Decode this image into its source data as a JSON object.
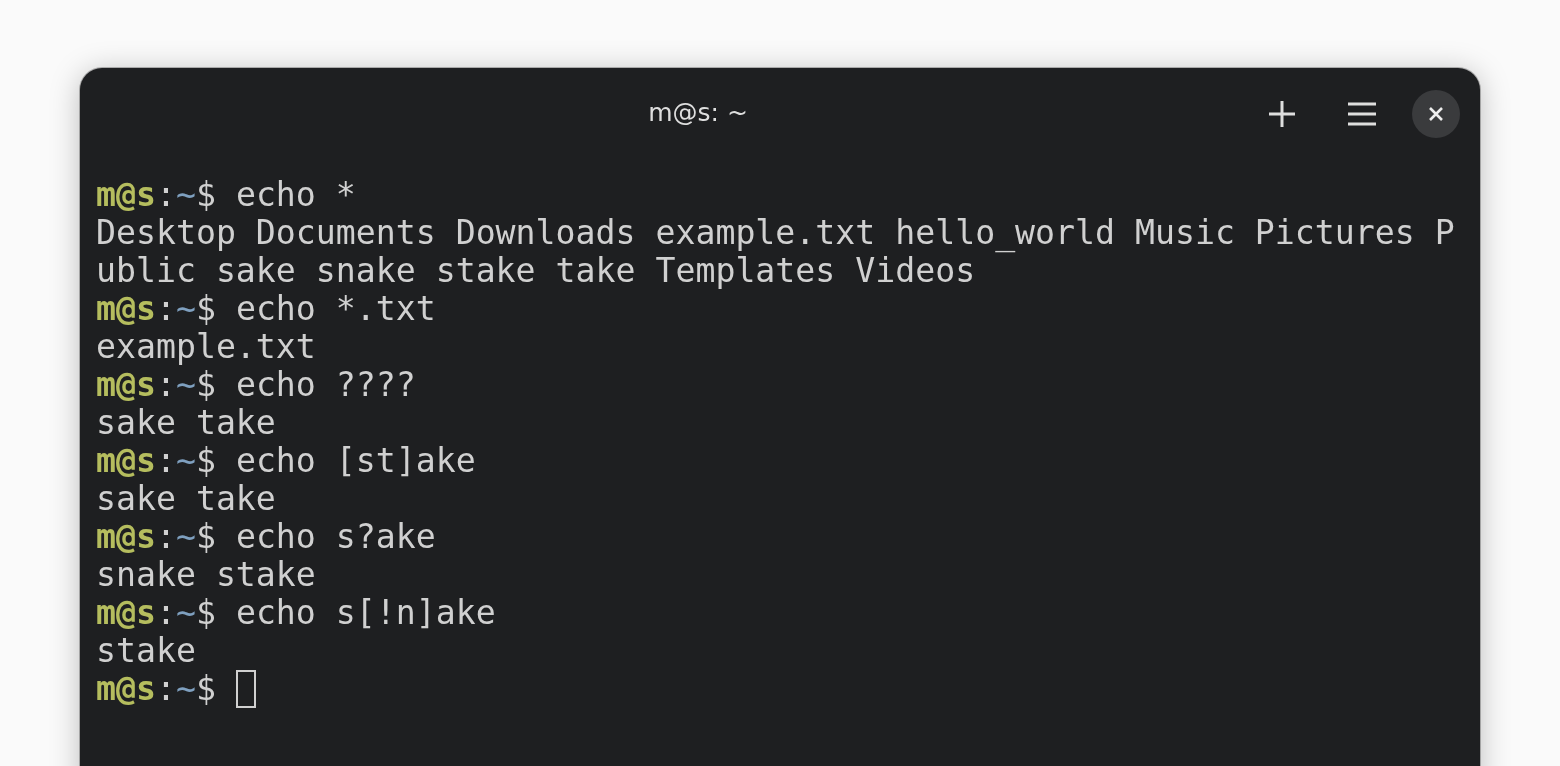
{
  "window": {
    "title": "m@s: ~"
  },
  "lines": [
    {
      "kind": "prompt",
      "user": "m@s",
      "sep": ":",
      "path": "~",
      "symbol": "$",
      "command": "echo *"
    },
    {
      "kind": "output",
      "text": "Desktop Documents Downloads example.txt hello_world Music Pictures P"
    },
    {
      "kind": "output",
      "text": "ublic sake snake stake take Templates Videos"
    },
    {
      "kind": "prompt",
      "user": "m@s",
      "sep": ":",
      "path": "~",
      "symbol": "$",
      "command": "echo *.txt"
    },
    {
      "kind": "output",
      "text": "example.txt"
    },
    {
      "kind": "prompt",
      "user": "m@s",
      "sep": ":",
      "path": "~",
      "symbol": "$",
      "command": "echo ????"
    },
    {
      "kind": "output",
      "text": "sake take"
    },
    {
      "kind": "prompt",
      "user": "m@s",
      "sep": ":",
      "path": "~",
      "symbol": "$",
      "command": "echo [st]ake"
    },
    {
      "kind": "output",
      "text": "sake take"
    },
    {
      "kind": "prompt",
      "user": "m@s",
      "sep": ":",
      "path": "~",
      "symbol": "$",
      "command": "echo s?ake"
    },
    {
      "kind": "output",
      "text": "snake stake"
    },
    {
      "kind": "prompt",
      "user": "m@s",
      "sep": ":",
      "path": "~",
      "symbol": "$",
      "command": "echo s[!n]ake"
    },
    {
      "kind": "output",
      "text": "stake"
    },
    {
      "kind": "prompt",
      "user": "m@s",
      "sep": ":",
      "path": "~",
      "symbol": "$",
      "cursor": true
    }
  ]
}
